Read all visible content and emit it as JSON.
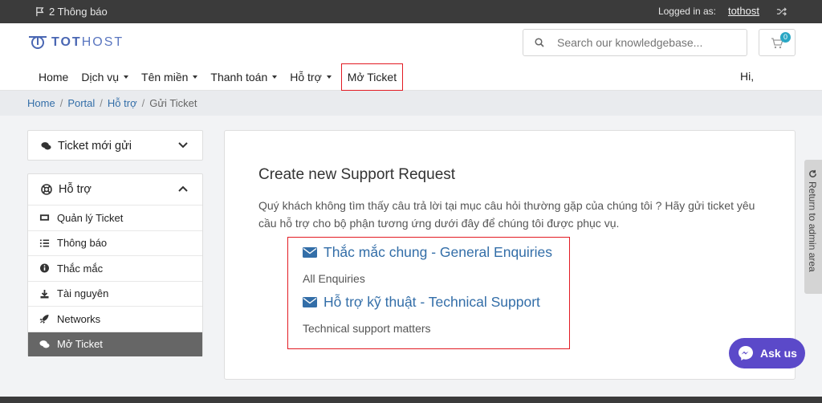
{
  "topbar": {
    "notifications": "2 Thông báo",
    "logged_in_label": "Logged in as:",
    "username": "tothost"
  },
  "header": {
    "logo_part1": "TOT",
    "logo_part2": "HOST",
    "search_placeholder": "Search our knowledgebase...",
    "cart_count": "0",
    "greeting": "Hi,",
    "brand_color": "#4a67b3"
  },
  "nav": {
    "items": [
      {
        "label": "Home"
      },
      {
        "label": "Dịch vụ"
      },
      {
        "label": "Tên miền"
      },
      {
        "label": "Thanh toán"
      },
      {
        "label": "Hỗ trợ"
      },
      {
        "label": "Mở Ticket"
      }
    ]
  },
  "breadcrumb": {
    "items": [
      "Home",
      "Portal",
      "Hỗ trợ"
    ],
    "current": "Gửi Ticket"
  },
  "sidebar": {
    "recent_tickets_title": "Ticket mới gửi",
    "support_title": "Hỗ trợ",
    "menu": [
      {
        "label": "Quản lý Ticket",
        "icon": "ticket-icon"
      },
      {
        "label": "Thông báo",
        "icon": "list-icon"
      },
      {
        "label": "Thắc mắc",
        "icon": "info-icon"
      },
      {
        "label": "Tài nguyên",
        "icon": "download-icon"
      },
      {
        "label": "Networks",
        "icon": "rocket-icon"
      },
      {
        "label": "Mở Ticket",
        "icon": "comments-icon"
      }
    ]
  },
  "main": {
    "title": "Create new Support Request",
    "description": "Quý khách không tìm thấy câu trả lời tại mục câu hỏi thường gặp của chúng tôi ? Hãy gửi ticket yêu cầu hỗ trợ cho bộ phận tương ứng dưới đây để chúng tôi được phục vụ.",
    "departments": [
      {
        "name": "Thắc mắc chung - General Enquiries",
        "description": "All Enquiries"
      },
      {
        "name": "Hỗ trợ kỹ thuật - Technical Support",
        "description": "Technical support matters"
      }
    ]
  },
  "return_admin": "Return to admin area",
  "ask_us": "Ask us"
}
